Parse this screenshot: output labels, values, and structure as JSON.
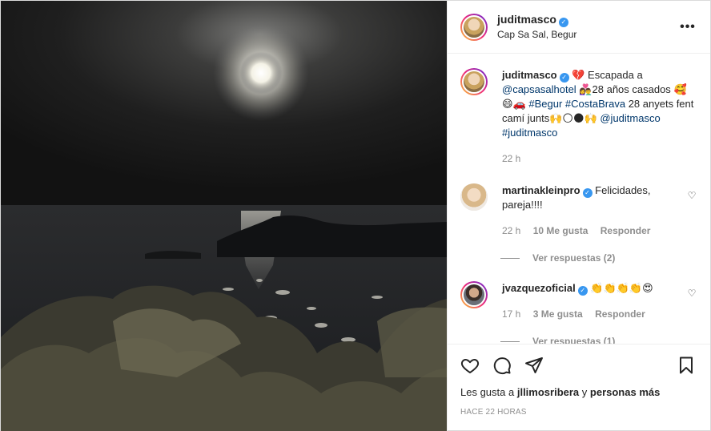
{
  "header": {
    "username": "juditmasco",
    "location": "Cap Sa Sal, Begur",
    "more_label": "•••"
  },
  "caption": {
    "username": "juditmasco",
    "text_1": "💔 Escapada a",
    "mention_1": "@capsasalhotel",
    "text_2": "👩‍❤️‍👨28 años casados",
    "text_3": "🥰😄🚗",
    "hashtag_1": "#Begur",
    "hashtag_2": "#CostaBrava",
    "text_4": "28 anyets fent camí junts🙌🌕🌑🙌",
    "mention_2": "@juditmasco",
    "hashtag_3": "#juditmasco",
    "time": "22 h"
  },
  "comments": [
    {
      "username": "martinakleinpro",
      "text": "Felicidades, pareja!!!!",
      "time": "22 h",
      "likes": "10 Me gusta",
      "reply": "Responder",
      "view_replies": "Ver respuestas (2)"
    },
    {
      "username": "jvazquezoficial",
      "text": "👏👏👏👏😍",
      "time": "17 h",
      "likes": "3 Me gusta",
      "reply": "Responder",
      "view_replies": "Ver respuestas (1)"
    }
  ],
  "footer": {
    "likes_prefix": "Les gusta a",
    "likes_user": "jllimosribera",
    "likes_middle": "y",
    "likes_suffix": "personas más",
    "date": "HACE 22 HORAS"
  },
  "icons": {
    "like": "heart-icon",
    "comment": "comment-icon",
    "share": "paper-plane-icon",
    "save": "bookmark-icon",
    "verified": "verified-badge-icon",
    "comment_like": "heart-outline-icon",
    "verified_glyph": "✓",
    "small_heart_glyph": "♡"
  },
  "colors": {
    "link": "#00376b",
    "verified": "#3897f0",
    "muted": "#8e8e8e"
  }
}
